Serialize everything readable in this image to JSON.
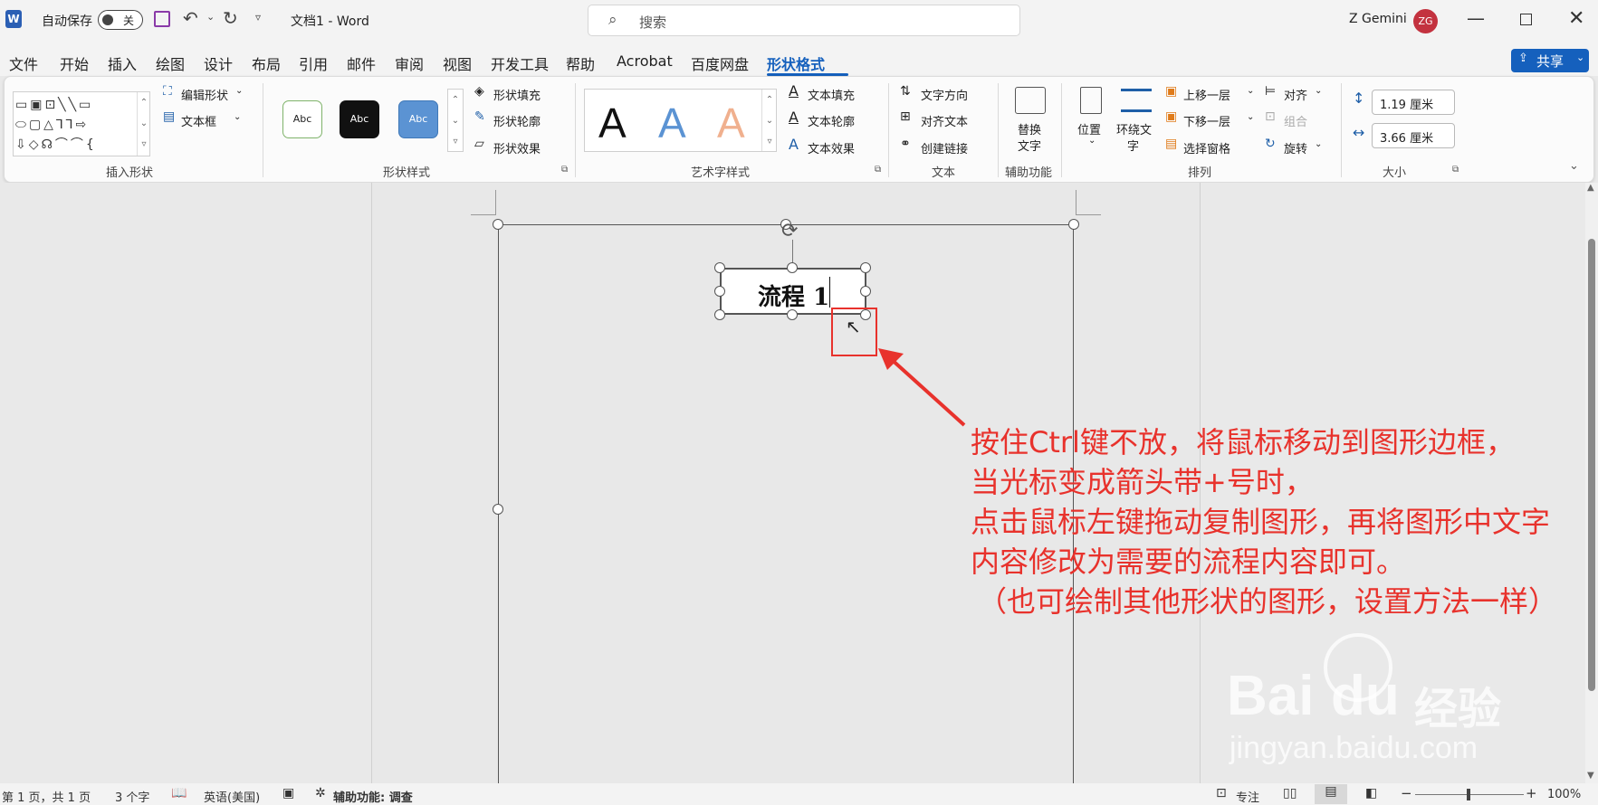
{
  "titlebar": {
    "app_icon": "word-icon",
    "autosave_label": "自动保存",
    "autosave_state": "关",
    "doc_title": "文档1 - Word",
    "search_placeholder": "搜索",
    "user_name": "Z Gemini",
    "user_initials": "ZG",
    "avatar_color": "#c3323f"
  },
  "menu": {
    "items": [
      "文件",
      "开始",
      "插入",
      "绘图",
      "设计",
      "布局",
      "引用",
      "邮件",
      "审阅",
      "视图",
      "开发工具",
      "帮助",
      "Acrobat",
      "百度网盘",
      "形状格式"
    ],
    "active": "形状格式",
    "share_label": "共享",
    "accent": "#1560bd"
  },
  "ribbon": {
    "insert_shapes": {
      "edit_shape": "编辑形状",
      "text_box": "文本框",
      "label": "插入形状"
    },
    "shape_styles": {
      "preset": "Abc",
      "fill": "形状填充",
      "outline": "形状轮廓",
      "effects": "形状效果",
      "label": "形状样式"
    },
    "wordart": {
      "letter": "A",
      "text_fill": "文本填充",
      "text_outline": "文本轮廓",
      "text_effects": "文本效果",
      "label": "艺术字样式"
    },
    "text": {
      "direction": "文字方向",
      "align": "对齐文本",
      "link": "创建链接",
      "label": "文本"
    },
    "accessibility": {
      "alt_text_line1": "替换",
      "alt_text_line2": "文字",
      "label": "辅助功能"
    },
    "arrange": {
      "position": "位置",
      "wrap_line1": "环绕文",
      "wrap_line2": "字",
      "bring_forward": "上移一层",
      "send_backward": "下移一层",
      "selection_pane": "选择窗格",
      "align": "对齐",
      "group": "组合",
      "rotate": "旋转",
      "label": "排列"
    },
    "size": {
      "height": "1.19 厘米",
      "width": "3.66 厘米",
      "label": "大小"
    }
  },
  "document": {
    "shape_text": "流程 1"
  },
  "annotation": {
    "line1": "按住Ctrl键不放，将鼠标移动到图形边框，",
    "line2": "当光标变成箭头带+号时，",
    "line3": "点击鼠标左键拖动复制图形，再将图形中文字",
    "line4": "内容修改为需要的流程内容即可。",
    "line5": "（也可绘制其他形状的图形，设置方法一样）",
    "color": "#e8322c"
  },
  "watermark": {
    "brand": "Bai",
    "brand2": "du",
    "suffix": "经验",
    "url": "jingyan.baidu.com"
  },
  "statusbar": {
    "page": "第 1 页，共 1 页",
    "words": "3 个字",
    "language": "英语(美国)",
    "accessibility": "辅助功能: 调查",
    "focus": "专注",
    "zoom": "100%"
  }
}
